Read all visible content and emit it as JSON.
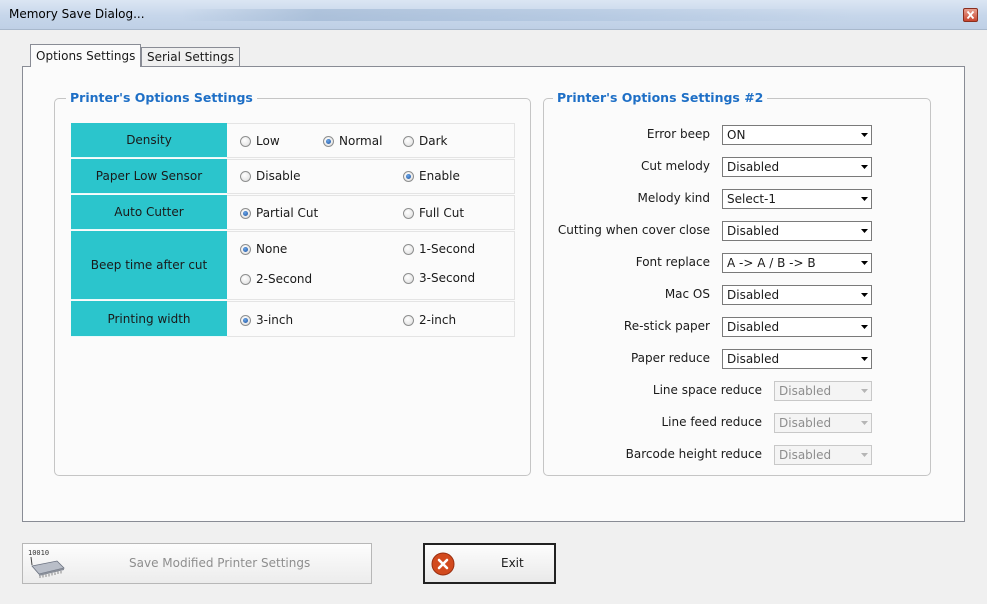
{
  "window": {
    "title": "Memory Save Dialog..."
  },
  "tabs": [
    {
      "label": "Options Settings",
      "active": true
    },
    {
      "label": "Serial Settings",
      "active": false
    }
  ],
  "group1": {
    "title": "Printer's Options Settings",
    "rows": [
      {
        "label": "Density",
        "options": [
          {
            "label": "Low",
            "checked": false
          },
          {
            "label": "Normal",
            "checked": true
          },
          {
            "label": "Dark",
            "checked": false
          }
        ]
      },
      {
        "label": "Paper Low Sensor",
        "options": [
          {
            "label": "Disable",
            "checked": false
          },
          {
            "label": "Enable",
            "checked": true
          }
        ]
      },
      {
        "label": "Auto Cutter",
        "options": [
          {
            "label": "Partial Cut",
            "checked": true
          },
          {
            "label": "Full Cut",
            "checked": false
          }
        ]
      },
      {
        "label": "Beep time after cut",
        "options": [
          {
            "label": "None",
            "checked": true
          },
          {
            "label": "1-Second",
            "checked": false
          },
          {
            "label": "2-Second",
            "checked": false
          },
          {
            "label": "3-Second",
            "checked": false
          }
        ]
      },
      {
        "label": "Printing width",
        "options": [
          {
            "label": "3-inch",
            "checked": true
          },
          {
            "label": "2-inch",
            "checked": false
          }
        ]
      }
    ]
  },
  "group2": {
    "title": "Printer's Options Settings #2",
    "rows": [
      {
        "label": "Error beep",
        "value": "ON",
        "enabled": true
      },
      {
        "label": "Cut melody",
        "value": "Disabled",
        "enabled": true
      },
      {
        "label": "Melody kind",
        "value": "Select-1",
        "enabled": true
      },
      {
        "label": "Cutting when cover close",
        "value": "Disabled",
        "enabled": true
      },
      {
        "label": "Font replace",
        "value": "A -> A / B -> B",
        "enabled": true
      },
      {
        "label": "Mac OS",
        "value": "Disabled",
        "enabled": true
      },
      {
        "label": "Re-stick paper",
        "value": "Disabled",
        "enabled": true
      },
      {
        "label": "Paper reduce",
        "value": "Disabled",
        "enabled": true
      },
      {
        "label": "Line space reduce",
        "value": "Disabled",
        "enabled": false
      },
      {
        "label": "Line feed reduce",
        "value": "Disabled",
        "enabled": false
      },
      {
        "label": "Barcode height reduce",
        "value": "Disabled",
        "enabled": false
      }
    ]
  },
  "buttons": {
    "save": {
      "label": "Save Modified Printer Settings",
      "icon": "memory-chip-icon",
      "icon_text": "10010",
      "enabled": false
    },
    "exit": {
      "label": "Exit",
      "icon": "close-circle-icon"
    }
  },
  "colors": {
    "label_cell": "#2bc5cc",
    "group_title": "#1e6fc6",
    "exit_icon": "#d24a1e"
  }
}
